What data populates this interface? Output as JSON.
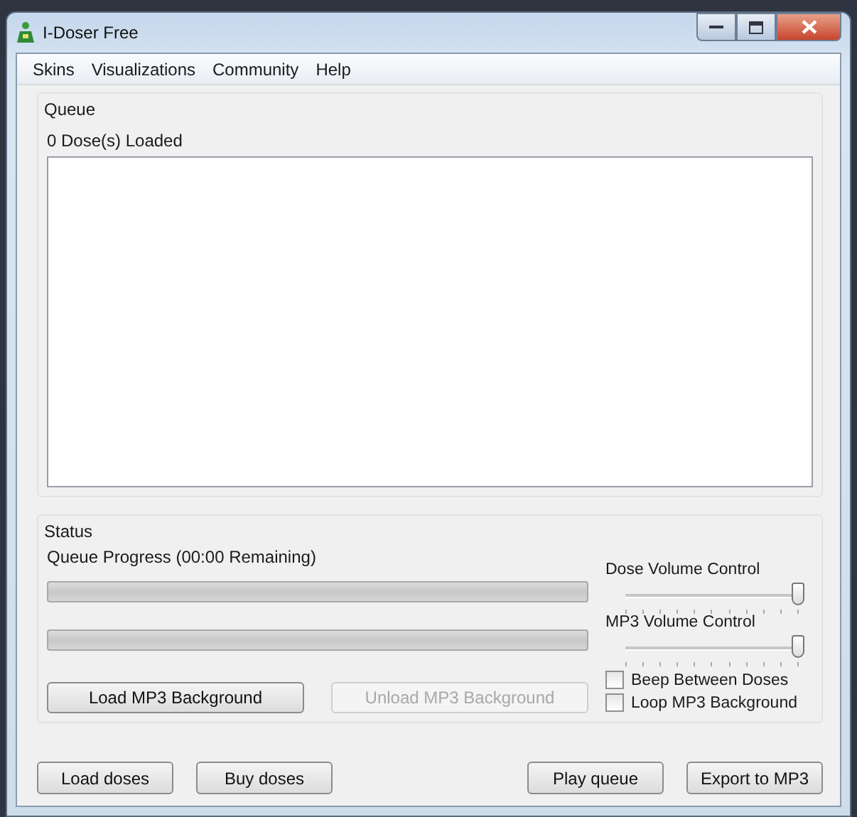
{
  "window": {
    "title": "I-Doser Free"
  },
  "menu": [
    "Skins",
    "Visualizations",
    "Community",
    "Help"
  ],
  "queue": {
    "title": "Queue",
    "count_label": "0 Dose(s) Loaded"
  },
  "status": {
    "title": "Status",
    "progress_label": "Queue Progress (00:00 Remaining)",
    "progress_bars": [
      {
        "level": 0
      },
      {
        "level": 0
      }
    ],
    "buttons": [
      {
        "label": "Load MP3 Background",
        "disabled": false
      },
      {
        "label": "Unload MP3 Background",
        "disabled": true
      }
    ],
    "sliders": [
      {
        "label": "Dose Volume Control",
        "level": 1
      },
      {
        "label": "MP3 Volume Control",
        "level": 1
      }
    ],
    "checkboxes": [
      {
        "label": "Beep Between Doses",
        "checked": false
      },
      {
        "label": "Loop MP3 Background",
        "checked": false
      }
    ]
  },
  "footer": {
    "left_buttons": [
      "Load doses",
      "Buy doses"
    ],
    "right_buttons": [
      "Play queue",
      "Export to MP3"
    ]
  }
}
